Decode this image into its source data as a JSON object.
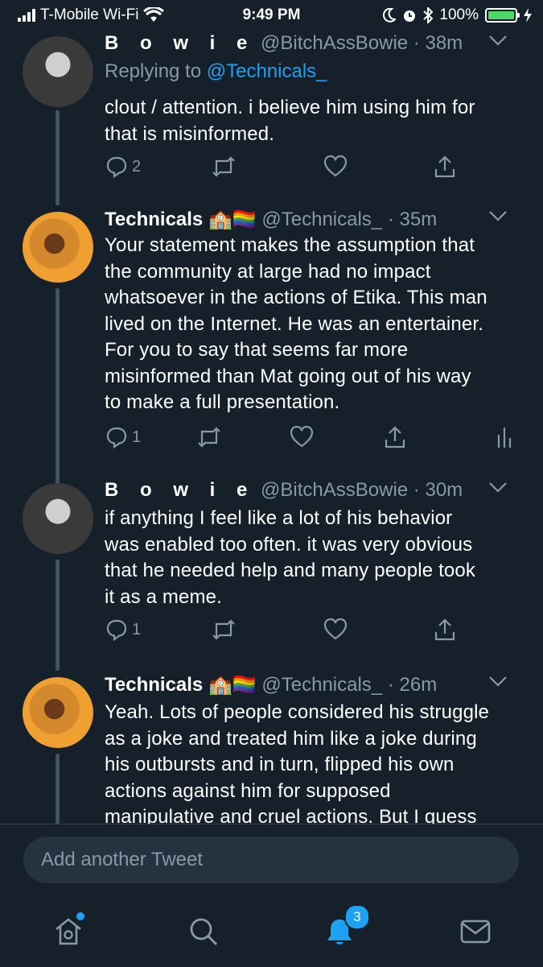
{
  "status_bar": {
    "carrier": "T-Mobile Wi-Fi",
    "time": "9:49 PM",
    "battery": "100%",
    "battery_level": 1.0
  },
  "tweets": [
    {
      "name": "B o w i e",
      "handle": "@BitchAssBowie",
      "sep": "·",
      "time": "38m",
      "reply_prefix": "Replying to ",
      "reply_to": "@Technicals_",
      "line1": "clout / attention. i believe him using him for",
      "line2": "that is misinformed.",
      "reply_count": "2"
    },
    {
      "name": "Technicals",
      "emoji": "🏫🏳️‍🌈",
      "handle": "@Technicals_",
      "sep": "·",
      "time": "35m",
      "line1": "Your statement makes the assumption that",
      "line2": "the community at large had no impact",
      "line3": "whatsoever in the actions of Etika. This man",
      "line4": "lived on the Internet. He was an entertainer.",
      "line5": "For you to say that seems far more",
      "line6": "misinformed than Mat going out of his way",
      "line7": "to make a full presentation.",
      "reply_count": "1"
    },
    {
      "name": "B o w i e",
      "handle": "@BitchAssBowie",
      "sep": "·",
      "time": "30m",
      "line1": "if anything I feel like a lot of his behavior",
      "line2": "was enabled too often. it was very obvious",
      "line3": "that he needed help and many people took",
      "line4": "it as a meme.",
      "reply_count": "1"
    },
    {
      "name": "Technicals",
      "emoji": "🏫🏳️‍🌈",
      "handle": "@Technicals_",
      "sep": "·",
      "time": "26m",
      "line1": "Yeah. Lots of people considered his struggle",
      "line2": "as a joke and treated him like a joke during",
      "line3": "his outbursts and in turn, flipped his own",
      "line4": "actions against him for supposed",
      "line5": "manipulative and cruel actions. But I guess"
    }
  ],
  "compose": {
    "placeholder": "Add another Tweet"
  },
  "tabbar": {
    "notifications_badge": "3"
  },
  "colors": {
    "background": "#15202b",
    "secondary_text": "#8899a6",
    "accent": "#1da1f2",
    "thread_line": "#3d5466"
  }
}
